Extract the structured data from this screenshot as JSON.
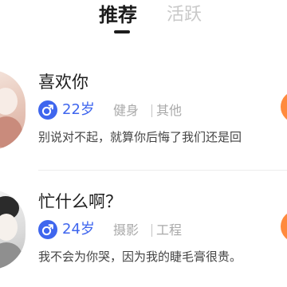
{
  "tabs": {
    "recommended": "推荐",
    "active": "活跃"
  },
  "users": [
    {
      "nickname": "喜欢你",
      "age": "22岁",
      "tags": [
        "健身",
        "其他"
      ],
      "bio": "别说对不起，就算你后悔了我们还是回"
    },
    {
      "nickname": "忙什么啊？",
      "age": "24岁",
      "tags": [
        "摄影",
        "工程"
      ],
      "bio": "我不会为你哭，因为我的睫毛膏很贵。"
    }
  ],
  "colors": {
    "accent_blue": "#3f66ee",
    "accent_orange": "#ff8a3d",
    "tab_active": "#1c1c1c",
    "tab_inactive": "#c9c9c9"
  },
  "icons": {
    "gender": "male-symbol-icon"
  }
}
